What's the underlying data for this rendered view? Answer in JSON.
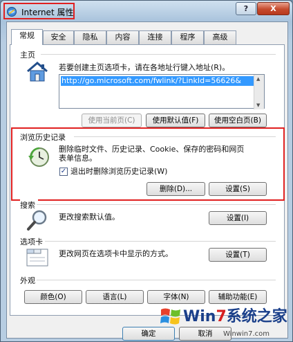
{
  "window": {
    "title": "Internet 属性",
    "help": "?",
    "close": "X"
  },
  "tabs": [
    "常规",
    "安全",
    "隐私",
    "内容",
    "连接",
    "程序",
    "高级"
  ],
  "homepage": {
    "heading": "主页",
    "instruction": "若要创建主页选项卡，请在各地址行键入地址(R)。",
    "url": "http://go.microsoft.com/fwlink/?LinkId=56626&",
    "use_current": "使用当前页(C)",
    "use_default": "使用默认值(F)",
    "use_blank": "使用空白页(B)"
  },
  "history": {
    "heading": "浏览历史记录",
    "description_line1": "删除临时文件、历史记录、Cookie、保存的密码和网页",
    "description_line2": "表单信息。",
    "checkbox_mark": "✓",
    "checkbox_label": "退出时删除浏览历史记录(W)",
    "delete": "删除(D)...",
    "settings": "设置(S)"
  },
  "search": {
    "heading": "搜索",
    "description": "更改搜索默认值。",
    "settings": "设置(I)"
  },
  "tabs_section": {
    "heading": "选项卡",
    "description": "更改网页在选项卡中显示的方式。",
    "settings": "设置(T)"
  },
  "appearance": {
    "heading": "外观",
    "colors": "颜色(O)",
    "languages": "语言(L)",
    "fonts": "字体(N)",
    "accessibility": "辅助功能(E)"
  },
  "footer": {
    "ok": "确定",
    "cancel": "取消"
  },
  "watermark": {
    "brand_a": "Win",
    "brand_b": "7",
    "brand_c": "系统之家",
    "url": "Winwin7.com"
  },
  "colors": {
    "highlight": "#e02020",
    "selection": "#3399ff"
  }
}
